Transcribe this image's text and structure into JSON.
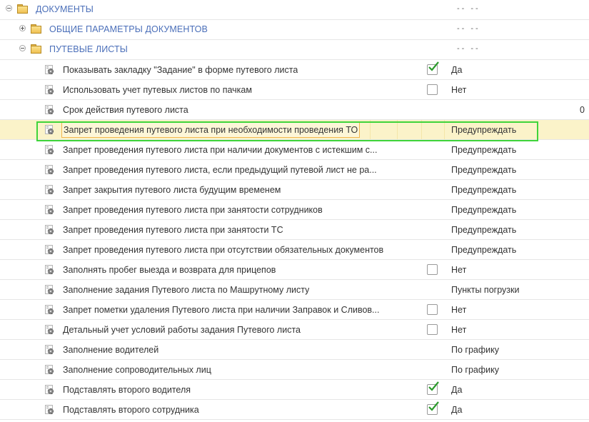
{
  "colors": {
    "group_text": "#4b6fb9",
    "highlight_bg": "#fbf3c9",
    "selection_frame": "#3fd43a",
    "checkmark": "#2b9a2b"
  },
  "groups": [
    {
      "label": "ДОКУМЕНТЫ",
      "expanded": true,
      "value": "-- --"
    },
    {
      "label": "ОБЩИЕ ПАРАМЕТРЫ ДОКУМЕНТОВ",
      "expanded": false,
      "value": "-- --"
    },
    {
      "label": "ПУТЕВЫЕ ЛИСТЫ",
      "expanded": true,
      "value": "-- --"
    }
  ],
  "settings": [
    {
      "label": "Показывать закладку \"Задание\" в форме путевого листа",
      "checkbox": true,
      "checked": true,
      "value": "Да"
    },
    {
      "label": "Использовать учет путевых листов по пачкам",
      "checkbox": true,
      "checked": false,
      "value": "Нет"
    },
    {
      "label": "Срок действия путевого листа",
      "checkbox": false,
      "value": "0"
    },
    {
      "label": "Запрет проведения путевого листа при необходимости проведения ТО",
      "checkbox": false,
      "value": "Предупреждать",
      "selected": true
    },
    {
      "label": "Запрет проведения путевого листа при наличии документов с истекшим с...",
      "checkbox": false,
      "value": "Предупреждать"
    },
    {
      "label": "Запрет проведения путевого листа, если предыдущий путевой лист не ра...",
      "checkbox": false,
      "value": "Предупреждать"
    },
    {
      "label": "Запрет закрытия путевого листа будущим временем",
      "checkbox": false,
      "value": "Предупреждать"
    },
    {
      "label": "Запрет проведения путевого листа при занятости сотрудников",
      "checkbox": false,
      "value": "Предупреждать"
    },
    {
      "label": "Запрет проведения путевого листа при занятости ТС",
      "checkbox": false,
      "value": "Предупреждать"
    },
    {
      "label": "Запрет проведения путевого листа при отсутствии обязательных документов",
      "checkbox": false,
      "value": "Предупреждать"
    },
    {
      "label": "Заполнять пробег выезда и возврата для прицепов",
      "checkbox": true,
      "checked": false,
      "value": "Нет"
    },
    {
      "label": "Заполнение задания Путевого листа по Машрутному листу",
      "checkbox": false,
      "value": "Пункты погрузки"
    },
    {
      "label": "Запрет пометки удаления Путевого листа при наличии Заправок и Сливов...",
      "checkbox": true,
      "checked": false,
      "value": "Нет"
    },
    {
      "label": "Детальный учет условий работы задания Путевого листа",
      "checkbox": true,
      "checked": false,
      "value": "Нет"
    },
    {
      "label": "Заполнение водителей",
      "checkbox": false,
      "value": "По графику"
    },
    {
      "label": "Заполнение сопроводительных лиц",
      "checkbox": false,
      "value": "По графику"
    },
    {
      "label": "Подставлять второго водителя",
      "checkbox": true,
      "checked": true,
      "value": "Да"
    },
    {
      "label": "Подставлять второго сотрудника",
      "checkbox": true,
      "checked": true,
      "value": "Да"
    }
  ]
}
